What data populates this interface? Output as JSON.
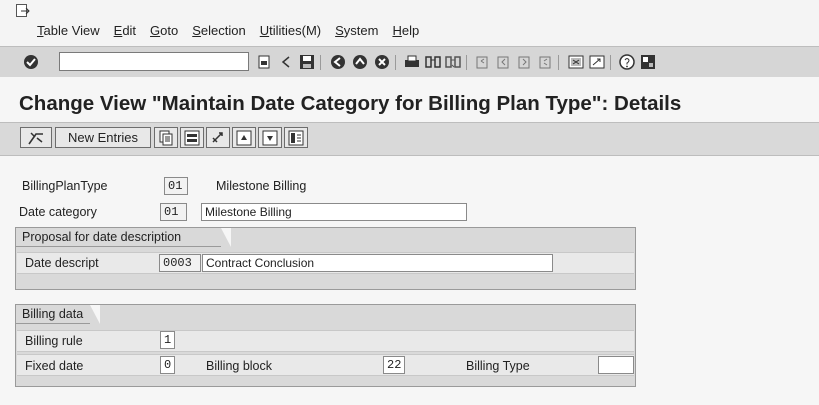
{
  "menubar": {
    "items": [
      "Table View",
      "Edit",
      "Goto",
      "Selection",
      "Utilities(M)",
      "System",
      "Help"
    ]
  },
  "app": {
    "title": "Change View \"Maintain Date Category for Billing Plan Type\": Details",
    "toolbar": {
      "new_entries_label": "New Entries"
    }
  },
  "form": {
    "billing_plan_type": {
      "label": "BillingPlanType",
      "value": "01",
      "text": "Milestone Billing"
    },
    "date_category": {
      "label": "Date category",
      "value": "01",
      "text": "Milestone Billing"
    },
    "proposal_group": {
      "title": "Proposal for date description",
      "date_descript": {
        "label": "Date descript",
        "code": "0003",
        "text": "Contract Conclusion"
      }
    },
    "billing_group": {
      "title": "Billing data",
      "billing_rule": {
        "label": "Billing rule",
        "value": "1"
      },
      "fixed_date": {
        "label": "Fixed date",
        "value": "0"
      },
      "billing_block": {
        "label": "Billing block",
        "value": "22"
      },
      "billing_type": {
        "label": "Billing Type",
        "value": ""
      }
    }
  },
  "colors": {
    "toolbar_bg": "#d6d6d6",
    "group_bg": "#d9d9d9",
    "field_bg": "#ffffff"
  }
}
